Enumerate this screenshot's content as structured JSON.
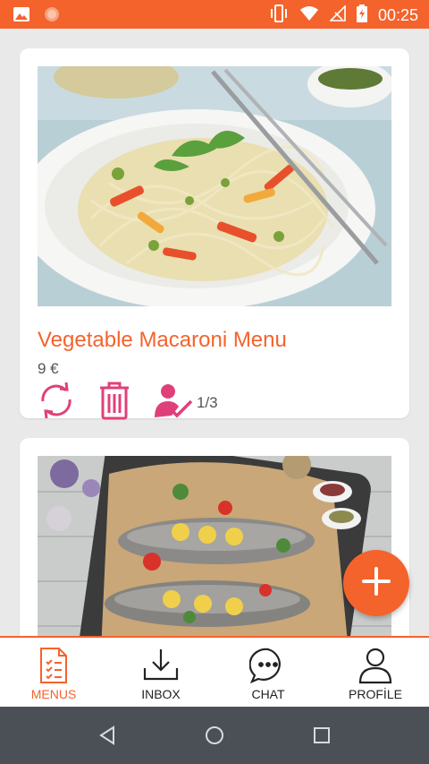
{
  "status_bar": {
    "time": "00:25",
    "icons": [
      "image-icon",
      "notification-dot-icon",
      "vibrate-icon",
      "wifi-icon",
      "no-signal-icon",
      "battery-charging-icon"
    ],
    "color": "#f4632c"
  },
  "menus": [
    {
      "title": "Vegetable Macaroni Menu",
      "price": "9 €",
      "portion": "1/3",
      "actions": [
        "refresh-icon",
        "trash-icon",
        "user-check-icon"
      ]
    },
    {
      "title": "",
      "price": "",
      "portion": ""
    }
  ],
  "fab": {
    "icon": "plus-icon"
  },
  "bottom_nav": {
    "items": [
      {
        "label": "MENUS",
        "icon": "document-icon",
        "active": true
      },
      {
        "label": "INBOX",
        "icon": "download-icon",
        "active": false
      },
      {
        "label": "CHAT",
        "icon": "chat-bubble-icon",
        "active": false
      },
      {
        "label": "PROFİLE",
        "icon": "user-icon",
        "active": false
      }
    ]
  },
  "colors": {
    "accent": "#f4632c",
    "action_pink": "#e0407a",
    "background": "#e9e9e9",
    "system_nav": "#4a5056"
  }
}
